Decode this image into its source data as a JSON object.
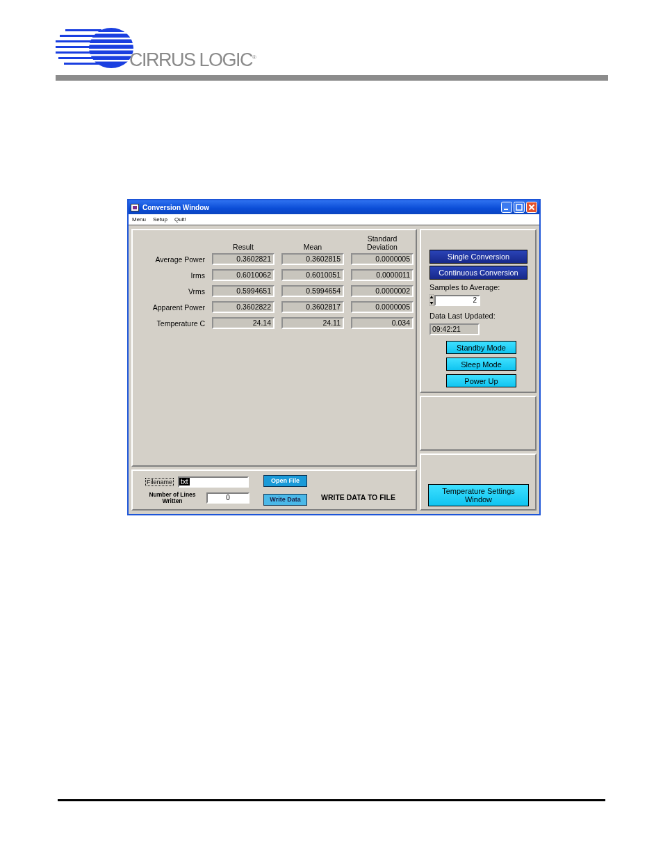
{
  "logo": {
    "text": "CIRRUS LOGIC$^{®}$"
  },
  "window": {
    "title": "Conversion Window",
    "menu": [
      "Menu",
      "Setup",
      "Quit!"
    ],
    "table": {
      "columns": [
        "Result",
        "Mean",
        "Standard Deviation"
      ],
      "rows": [
        {
          "label": "Average Power",
          "values": [
            "0.3602821",
            "0.3602815",
            "0.0000005"
          ]
        },
        {
          "label": "Irms",
          "values": [
            "0.6010062",
            "0.6010051",
            "0.0000011"
          ]
        },
        {
          "label": "Vrms",
          "values": [
            "0.5994651",
            "0.5994654",
            "0.0000002"
          ]
        },
        {
          "label": "Apparent Power",
          "values": [
            "0.3602822",
            "0.3602817",
            "0.0000005"
          ]
        },
        {
          "label": "Temperature C",
          "values": [
            "24.14",
            "24.11",
            "0.034"
          ]
        }
      ]
    },
    "file_panel": {
      "filename_label": "Filename",
      "filename_value": "txt",
      "lines_label": "Number of Lines Written",
      "lines_value": "0",
      "open_button": "Open File",
      "write_button": "Write Data",
      "note": "WRITE DATA TO FILE"
    },
    "conversion_buttons": [
      {
        "label": "Single Conversion",
        "kind": "dark"
      },
      {
        "label": "Continuous Conversion",
        "kind": "dark"
      }
    ],
    "samples": {
      "label": "Samples to Average:",
      "value": "2"
    },
    "updated": {
      "label": "Data Last Updated:",
      "value": "09:42:21"
    },
    "mode_buttons": [
      {
        "label": "Standby Mode",
        "kind": "cyan"
      },
      {
        "label": "Sleep Mode",
        "kind": "cyan"
      },
      {
        "label": "Power Up",
        "kind": "cyan"
      }
    ],
    "settings_button": {
      "label": "Temperature Settings Window",
      "kind": "cyan"
    }
  }
}
